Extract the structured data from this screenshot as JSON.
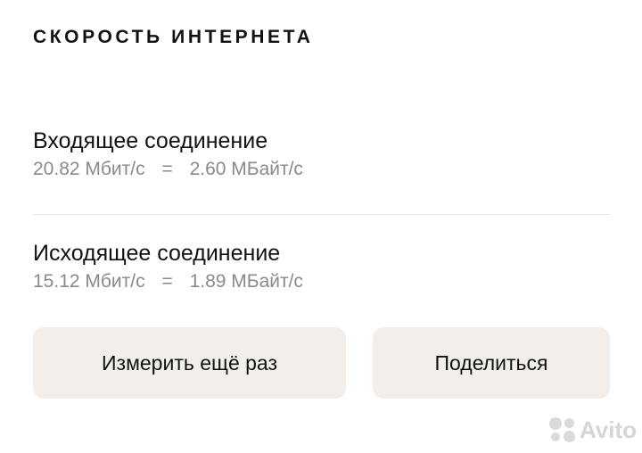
{
  "header": {
    "title": "СКОРОСТЬ ИНТЕРНЕТА"
  },
  "incoming": {
    "label": "Входящее соединение",
    "mbit": "20.82 Мбит/с",
    "equals": "=",
    "mbyte": "2.60 МБайт/с"
  },
  "outgoing": {
    "label": "Исходящее соединение",
    "mbit": "15.12 Мбит/с",
    "equals": "=",
    "mbyte": "1.89 МБайт/с"
  },
  "actions": {
    "retry_label": "Измерить ещё раз",
    "share_label": "Поделиться"
  },
  "watermark": {
    "text": "Avito"
  },
  "colors": {
    "button_bg": "#f2efea",
    "secondary_text": "#8a8a8a",
    "divider": "#e4e4e4"
  }
}
